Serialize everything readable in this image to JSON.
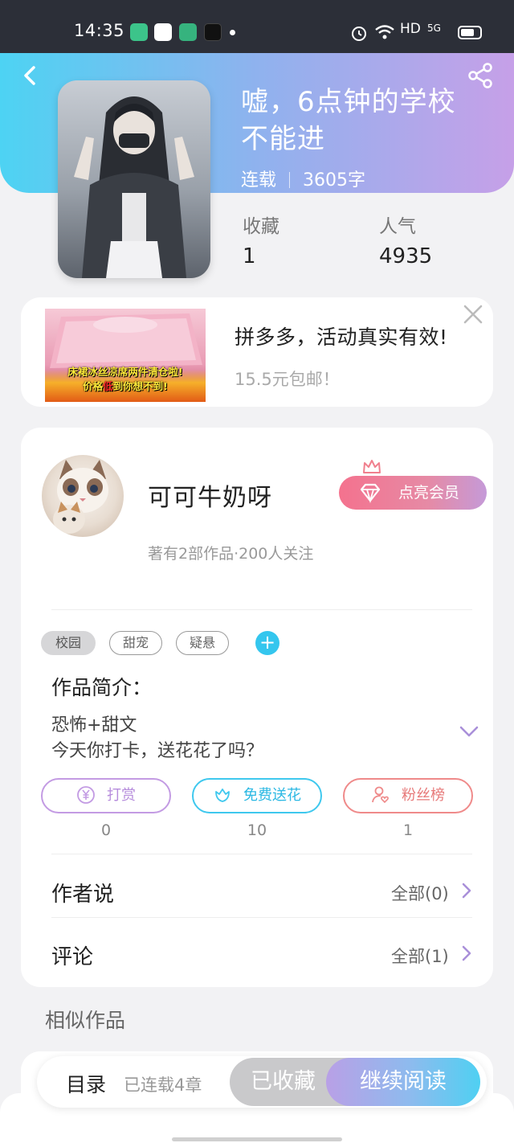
{
  "status_bar": {
    "time": "14:35",
    "network": "HD",
    "signal": "5G"
  },
  "book": {
    "title": "嘘，6点钟的学校不能进",
    "status": "连载",
    "word_count": "3605字",
    "stats": [
      {
        "label": "收藏",
        "value": "1"
      },
      {
        "label": "人气",
        "value": "4935"
      }
    ]
  },
  "ad": {
    "title": "拼多多，活动真实有效!",
    "subtitle": "15.5元包邮！",
    "image_caption_line1": "床裙冰丝凉席两件清仓啦!",
    "image_caption_line2_a": "价格",
    "image_caption_line2_b": "低",
    "image_caption_line2_c": "到你想不到!"
  },
  "author": {
    "name": "可可牛奶呀",
    "meta": "著有2部作品·200人关注",
    "vip_label": "点亮会员"
  },
  "tags": [
    "校园",
    "甜宠",
    "疑悬"
  ],
  "intro": {
    "title": "作品简介：",
    "lines": [
      "恐怖+甜文",
      "今天你打卡，送花花了吗？"
    ]
  },
  "actions": [
    {
      "label": "打赏",
      "count": "0"
    },
    {
      "label": "免费送花",
      "count": "10"
    },
    {
      "label": "粉丝榜",
      "count": "1"
    }
  ],
  "rows": [
    {
      "title": "作者说",
      "more": "全部(0)"
    },
    {
      "title": "评论",
      "more": "全部(1)"
    }
  ],
  "similar": {
    "title": "相似作品"
  },
  "bottom_bar": {
    "toc_label": "目录",
    "toc_sub": "已连载4章",
    "collected_label": "已收藏",
    "read_label": "继续阅读"
  },
  "colors": {
    "accent_cyan": "#34c6ee",
    "accent_purple": "#b9a0e6",
    "tip_purple": "#c39be3",
    "flower_cyan": "#3fc8ee",
    "fans_red": "#ef8a8a"
  }
}
